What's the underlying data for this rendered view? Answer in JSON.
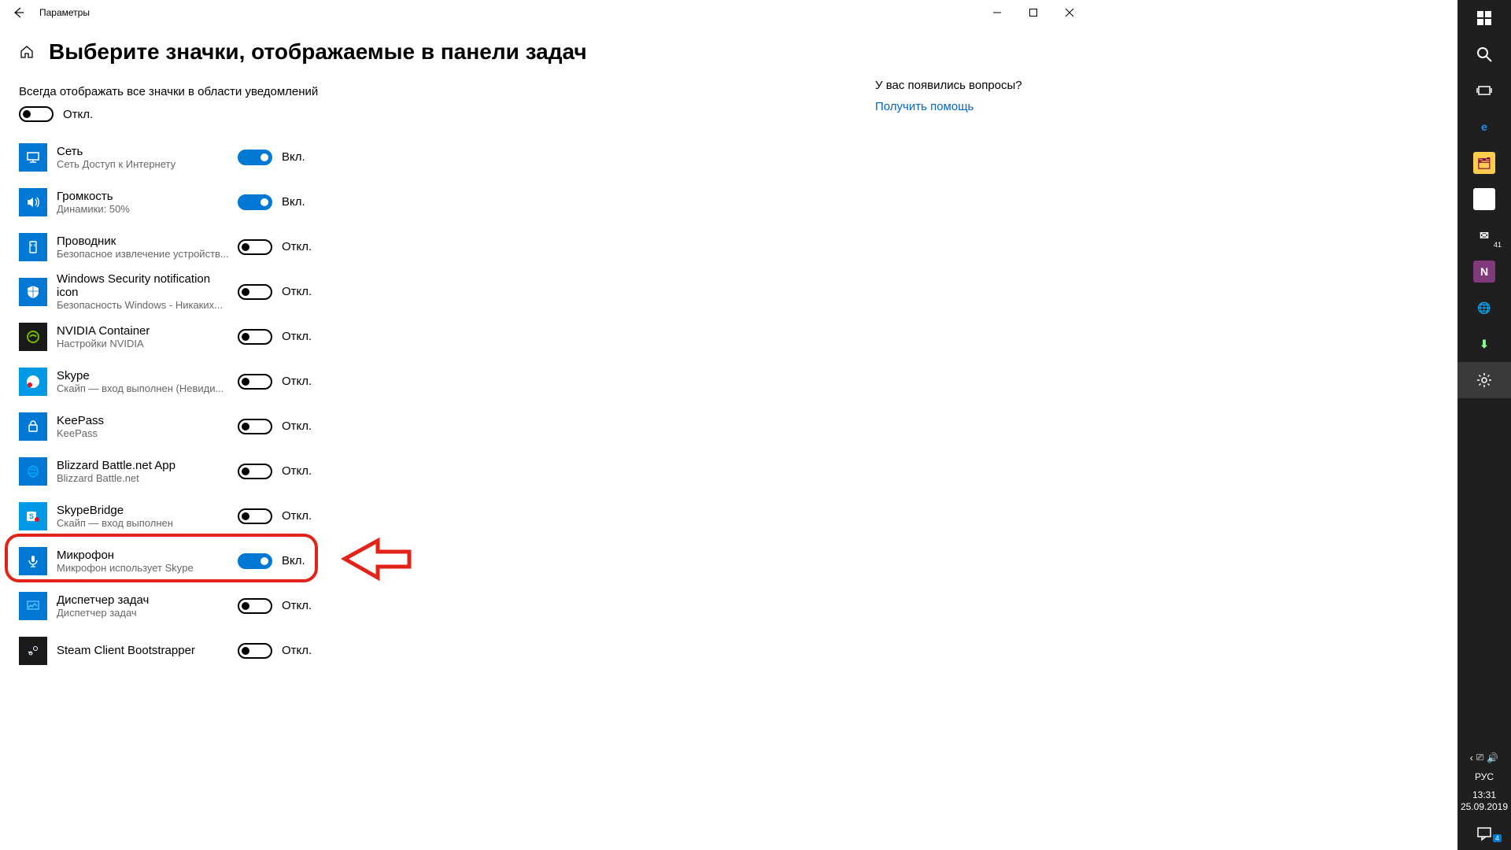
{
  "window": {
    "title": "Параметры",
    "page_title": "Выберите значки, отображаемые в панели задач"
  },
  "labels": {
    "always_show": "Всегда отображать все значки в области уведомлений",
    "on": "Вкл.",
    "off": "Откл."
  },
  "master_toggle": {
    "state": "off"
  },
  "items": [
    {
      "name": "Сеть",
      "sub": "Сеть Доступ к Интернету",
      "state": "on",
      "icon": "network",
      "box": "blue"
    },
    {
      "name": "Громкость",
      "sub": "Динамики: 50%",
      "state": "on",
      "icon": "speaker",
      "box": "blue"
    },
    {
      "name": "Проводник",
      "sub": "Безопасное извлечение устройств...",
      "state": "off",
      "icon": "usb",
      "box": "blue"
    },
    {
      "name": "Windows Security notification icon",
      "sub": "Безопасность Windows - Никаких...",
      "state": "off",
      "icon": "shield",
      "box": "blue"
    },
    {
      "name": "NVIDIA Container",
      "sub": "Настройки NVIDIA",
      "state": "off",
      "icon": "nvidia",
      "box": "dark"
    },
    {
      "name": "Skype",
      "sub": "Скайп — вход выполнен (Невиди...",
      "state": "off",
      "icon": "skype",
      "box": "sky"
    },
    {
      "name": "KeePass",
      "sub": "KeePass",
      "state": "off",
      "icon": "keepass",
      "box": "blue"
    },
    {
      "name": "Blizzard Battle.net App",
      "sub": "Blizzard Battle.net",
      "state": "off",
      "icon": "blizzard",
      "box": "blue"
    },
    {
      "name": "SkypeBridge",
      "sub": "Скайп — вход выполнен",
      "state": "off",
      "icon": "skypebridge",
      "box": "sky"
    },
    {
      "name": "Микрофон",
      "sub": "Микрофон использует Skype",
      "state": "on",
      "icon": "mic",
      "box": "blue",
      "highlight": true
    },
    {
      "name": "Диспетчер задач",
      "sub": "Диспетчер задач",
      "state": "off",
      "icon": "taskmgr",
      "box": "blue"
    },
    {
      "name": "Steam Client Bootstrapper",
      "sub": "",
      "state": "off",
      "icon": "steam",
      "box": "dark"
    }
  ],
  "side": {
    "question": "У вас появились вопросы?",
    "help_link": "Получить помощь"
  },
  "taskbar": {
    "mail_badge": "41",
    "notif_badge": "4",
    "lang": "РУС",
    "time": "13:31",
    "date": "25.09.2019"
  }
}
